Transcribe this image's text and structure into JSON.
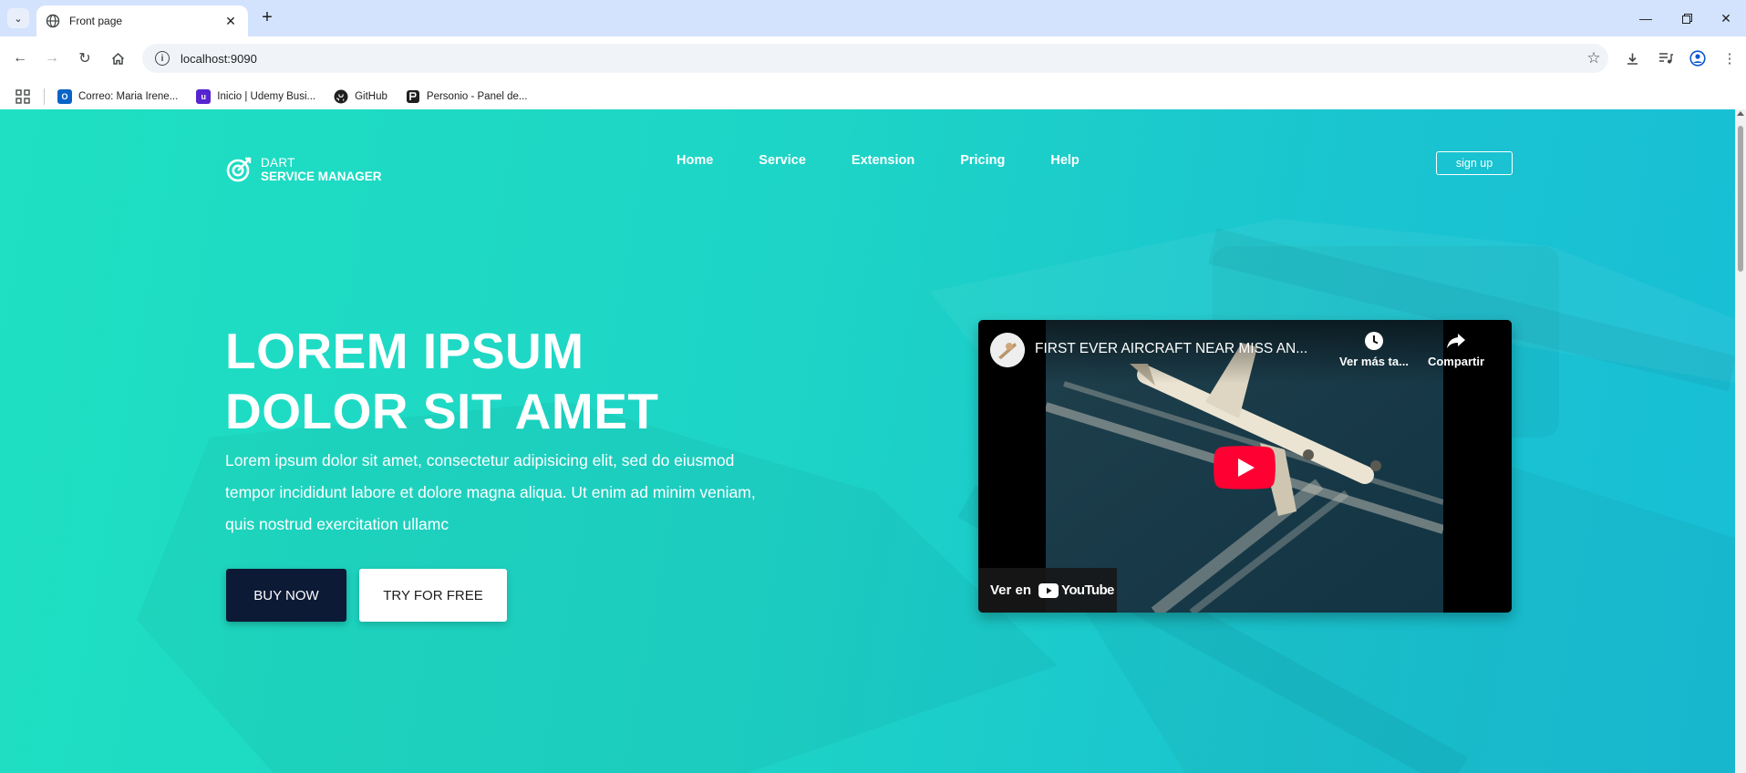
{
  "browser": {
    "tab": {
      "title": "Front page"
    },
    "address": {
      "url": "localhost:9090"
    },
    "bookmarks": [
      {
        "label": "Correo: Maria Irene...",
        "icon": "outlook-icon",
        "color": "#0a64c8"
      },
      {
        "label": "Inicio | Udemy Busi...",
        "icon": "udemy-icon",
        "color": "#5624d0"
      },
      {
        "label": "GitHub",
        "icon": "github-icon",
        "color": "#1f1f1f"
      },
      {
        "label": "Personio - Panel de...",
        "icon": "personio-icon",
        "color": "#1f1f1f"
      }
    ]
  },
  "site": {
    "logo": {
      "line1": "DART",
      "line2": "SERVICE MANAGER"
    },
    "nav": [
      "Home",
      "Service",
      "Extension",
      "Pricing",
      "Help"
    ],
    "signup_label": "sign up"
  },
  "hero": {
    "title_line1": "LOREM IPSUM",
    "title_line2": "DOLOR SIT AMET",
    "description": "Lorem ipsum dolor sit amet, consectetur adipisicing elit, sed do eiusmod tempor incididunt labore et dolore magna aliqua. Ut enim ad minim veniam, quis nostrud exercitation ullamc",
    "buy_label": "BUY NOW",
    "try_label": "TRY FOR FREE"
  },
  "video": {
    "title": "FIRST EVER AIRCRAFT NEAR MISS AN...",
    "watch_later": "Ver más ta...",
    "share": "Compartir",
    "watch_on": "Ver en",
    "platform": "YouTube"
  },
  "colors": {
    "hero_gradient_start": "#1fe0c2",
    "hero_gradient_end": "#18bed6",
    "buy_button": "#0c1a36",
    "play_button": "#ff0033"
  }
}
